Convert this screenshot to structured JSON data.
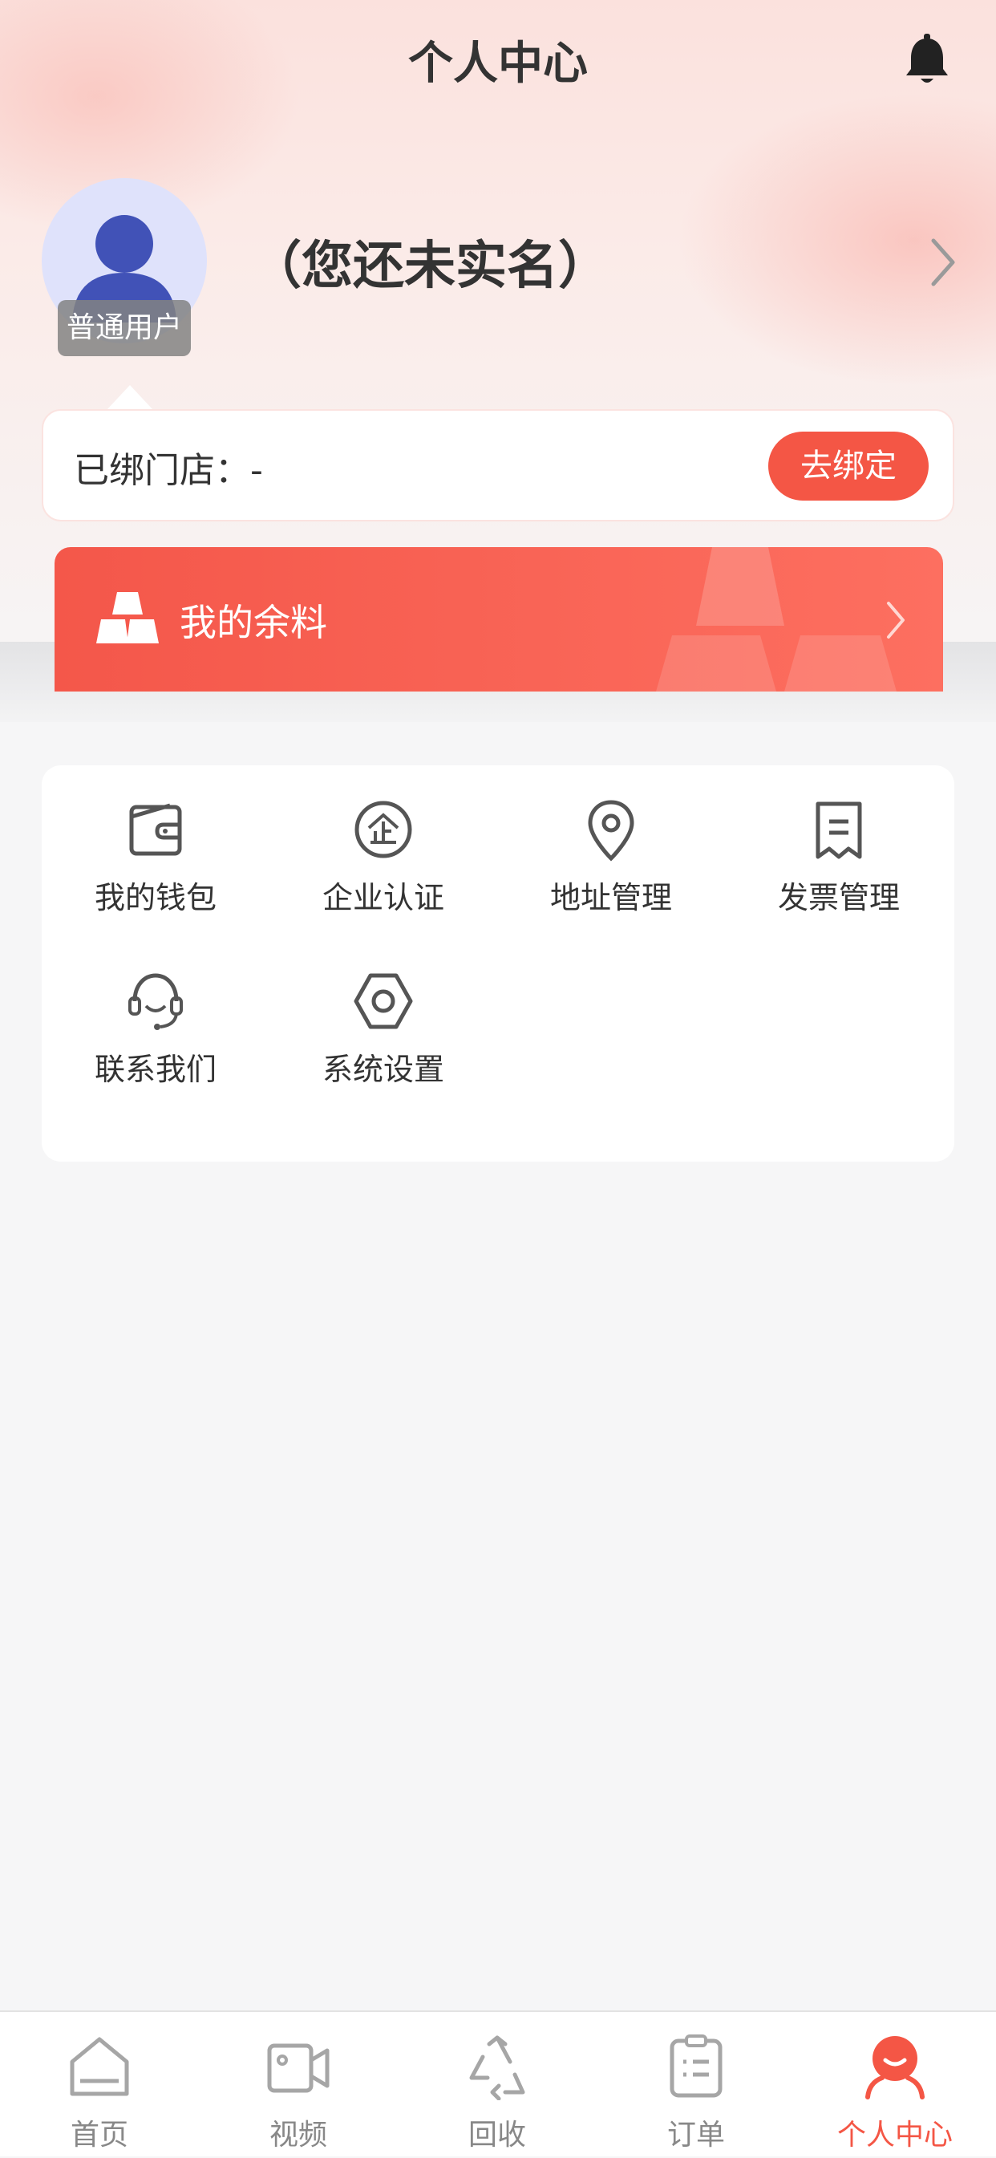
{
  "header": {
    "title": "个人中心",
    "notification_icon": "bell-icon"
  },
  "profile": {
    "badge": "普通用户",
    "name": "（您还未实名）",
    "avatar_icon": "user-avatar-icon"
  },
  "store": {
    "label": "已绑门店：-",
    "bind_button": "去绑定"
  },
  "balance": {
    "label": "我的余料",
    "icon": "gold-bars-icon"
  },
  "menu": [
    {
      "label": "我的钱包",
      "icon": "wallet-icon"
    },
    {
      "label": "企业认证",
      "icon": "enterprise-icon"
    },
    {
      "label": "地址管理",
      "icon": "location-pin-icon"
    },
    {
      "label": "发票管理",
      "icon": "invoice-icon"
    },
    {
      "label": "联系我们",
      "icon": "headset-icon"
    },
    {
      "label": "系统设置",
      "icon": "settings-icon"
    }
  ],
  "tabbar": [
    {
      "label": "首页",
      "icon": "home-icon",
      "active": false
    },
    {
      "label": "视频",
      "icon": "video-icon",
      "active": false
    },
    {
      "label": "回收",
      "icon": "recycle-icon",
      "active": false
    },
    {
      "label": "订单",
      "icon": "orders-icon",
      "active": false
    },
    {
      "label": "个人中心",
      "icon": "profile-icon",
      "active": true
    }
  ],
  "colors": {
    "accent": "#f45645",
    "text": "#333333",
    "muted": "#888888",
    "avatar": "#4152b7"
  }
}
